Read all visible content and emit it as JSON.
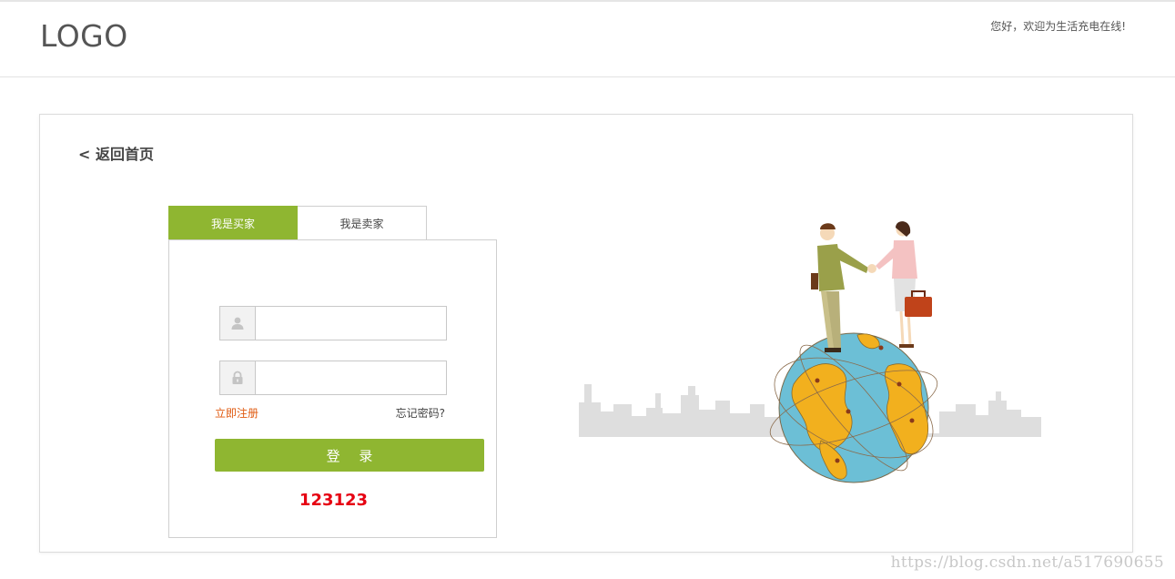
{
  "header": {
    "logo": "LOGO",
    "welcome": "您好，欢迎为生活充电在线!"
  },
  "panel": {
    "back_link": "< 返回首页",
    "tabs": [
      {
        "label": "我是买家",
        "active": true
      },
      {
        "label": "我是卖家",
        "active": false
      }
    ],
    "form": {
      "username": {
        "value": "",
        "placeholder": "",
        "icon": "user-icon"
      },
      "password": {
        "value": "",
        "placeholder": "",
        "icon": "lock-icon"
      },
      "register_link": "立即注册",
      "forgot_link": "忘记密码?",
      "login_button": "登 录",
      "code_text": "123123"
    }
  },
  "watermark": "https://blog.csdn.net/a517690655",
  "colors": {
    "accent": "#8fb631",
    "register": "#e05a10",
    "code": "#e60012",
    "ocean": "#6cbfd6",
    "land": "#f2b01e"
  }
}
